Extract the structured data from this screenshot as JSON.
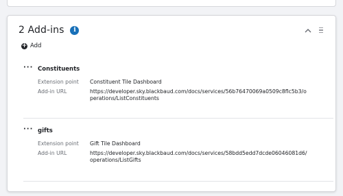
{
  "tile": {
    "title": "2 Add-ins",
    "help_glyph": "i",
    "add_label": "Add",
    "addins": [
      {
        "name": "Constituents",
        "extension_point_label": "Extension point",
        "extension_point": "Constituent Tile Dashboard",
        "url_label": "Add-in URL",
        "url": "https://developer.sky.blackbaud.com/docs/services/56b76470069a0509c8flc5b3/operations/ListConstituents"
      },
      {
        "name": "gifts",
        "extension_point_label": "Extension point",
        "extension_point": "Gift Tile Dashboard",
        "url_label": "Add-in URL",
        "url": "https://developer.sky.blackbaud.com/docs/services/58bdd5edd7dcde06046081d6/operations/ListGifts"
      }
    ]
  },
  "icons": {
    "help": "info-circle-icon",
    "chevron": "chevron-up-icon",
    "drag": "drag-handle-icon",
    "add": "plus-circle-icon",
    "menu": "ellipsis-icon"
  },
  "colors": {
    "accent": "#1870b8",
    "text": "#212327",
    "muted": "#686c73",
    "border": "#d6d7db",
    "background": "#f2f3f6"
  }
}
